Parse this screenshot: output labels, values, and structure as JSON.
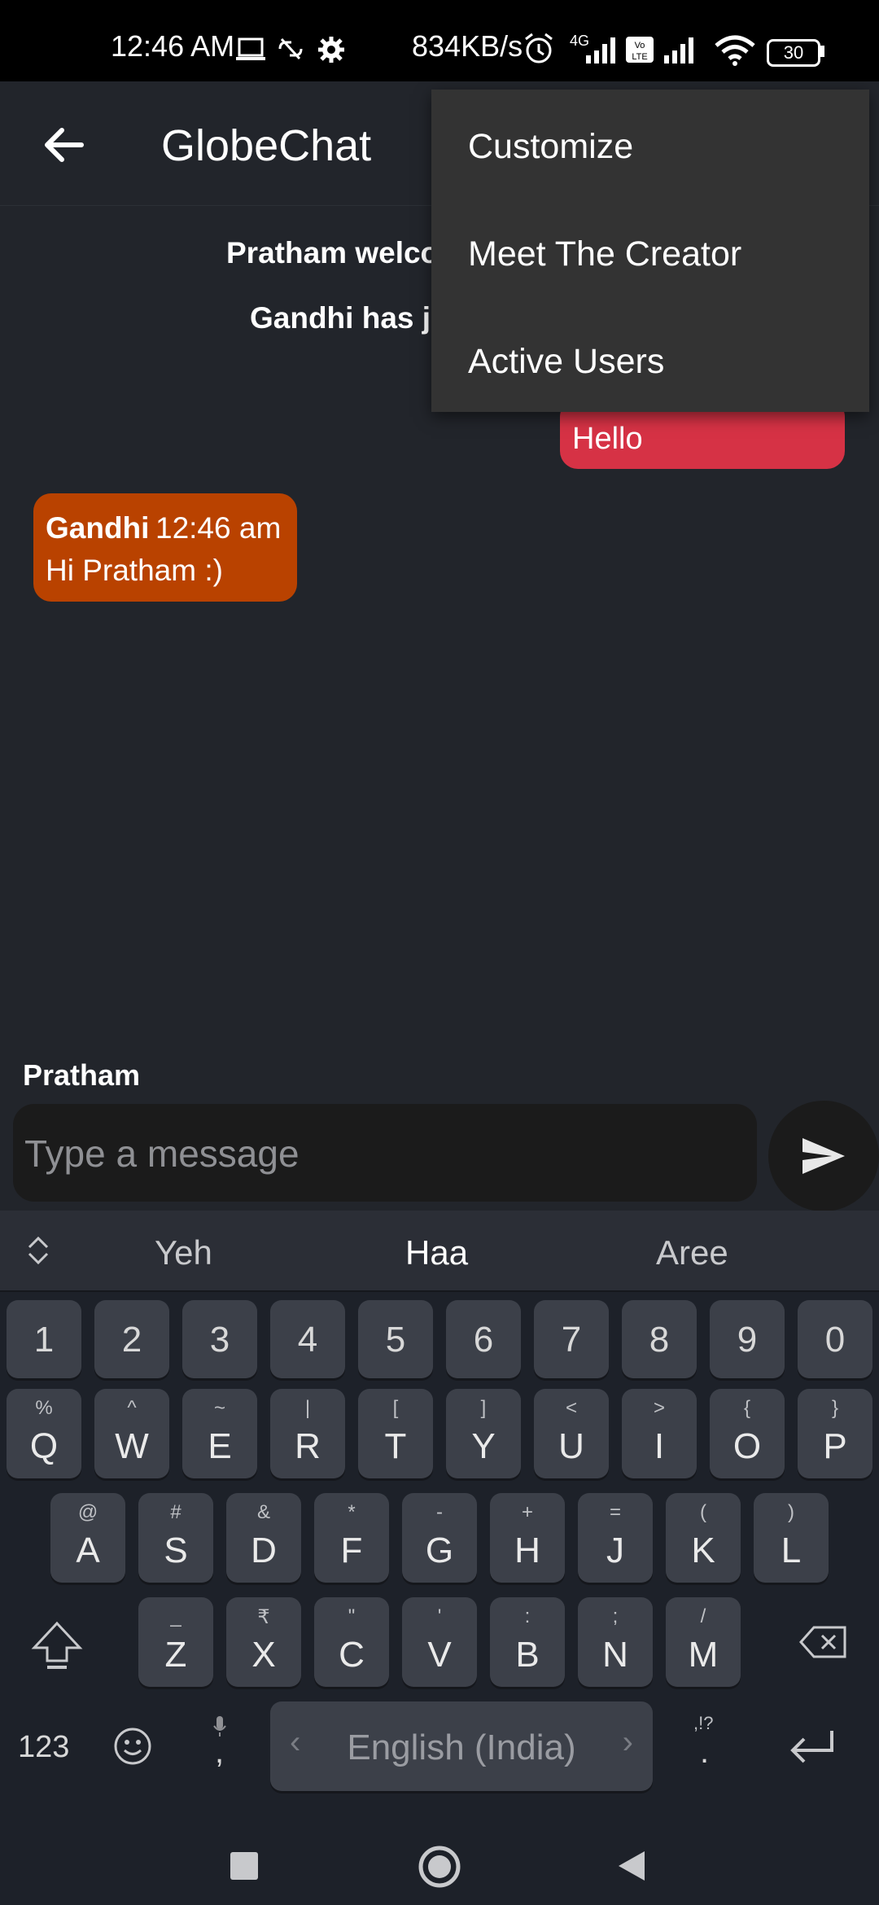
{
  "status_bar": {
    "time": "12:46 AM",
    "speed": "834KB/s",
    "network": "4G",
    "battery": "30"
  },
  "app_bar": {
    "title": "GlobeChat",
    "back_icon": "arrow-left-icon"
  },
  "chat": {
    "system_messages": [
      "Pratham welco",
      "Gandhi has jo"
    ],
    "outgoing": {
      "text": "Hello",
      "color": "#d63245"
    },
    "incoming": {
      "sender": "Gandhi",
      "time": "12:46 am",
      "text": "Hi Pratham :)",
      "color": "#b94200"
    }
  },
  "menu": {
    "items": [
      "Customize",
      "Meet The Creator",
      "Active Users"
    ]
  },
  "composer": {
    "username": "Pratham",
    "placeholder": "Type a message",
    "send_icon": "send-icon"
  },
  "keyboard": {
    "suggestions": [
      "Yeh",
      "Haa",
      "Aree"
    ],
    "numbers": [
      "1",
      "2",
      "3",
      "4",
      "5",
      "6",
      "7",
      "8",
      "9",
      "0"
    ],
    "row1": [
      [
        "Q",
        "%"
      ],
      [
        "W",
        "^"
      ],
      [
        "E",
        "~"
      ],
      [
        "R",
        "|"
      ],
      [
        "T",
        "["
      ],
      [
        "Y",
        "]"
      ],
      [
        "U",
        "<"
      ],
      [
        "I",
        ">"
      ],
      [
        "O",
        "{"
      ],
      [
        "P",
        "}"
      ]
    ],
    "row2": [
      [
        "A",
        "@"
      ],
      [
        "S",
        "#"
      ],
      [
        "D",
        "&"
      ],
      [
        "F",
        "*"
      ],
      [
        "G",
        "-"
      ],
      [
        "H",
        "+"
      ],
      [
        "J",
        "="
      ],
      [
        "K",
        "("
      ],
      [
        "L",
        ")"
      ]
    ],
    "row3": [
      [
        "Z",
        "_"
      ],
      [
        "X",
        "₹"
      ],
      [
        "C",
        "\""
      ],
      [
        "V",
        "'"
      ],
      [
        "B",
        ":"
      ],
      [
        "N",
        ";"
      ],
      [
        "M",
        "/"
      ]
    ],
    "mode_label": "123",
    "comma": ",",
    "period": ".",
    "period_hint": ",!?",
    "space_label": "English (India)"
  },
  "colors": {
    "background": "#22252b",
    "accent_outgoing": "#d63245",
    "accent_incoming": "#b94200"
  }
}
